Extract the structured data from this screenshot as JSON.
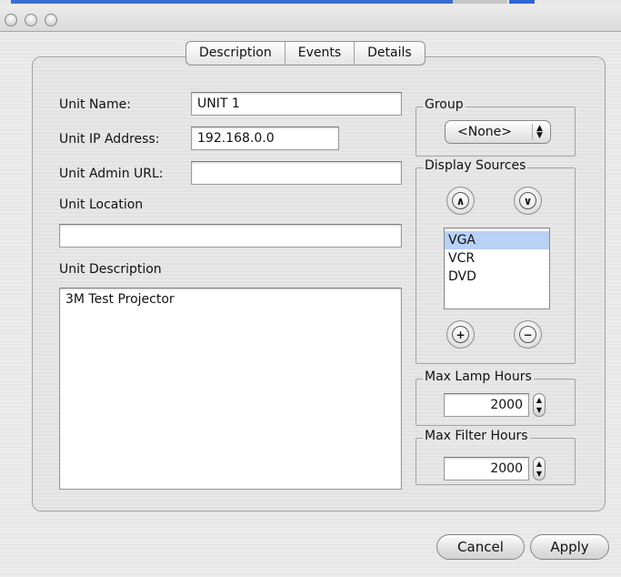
{
  "window": {
    "tabs": [
      "Description",
      "Events",
      "Details"
    ]
  },
  "form": {
    "unit_name_label": "Unit Name:",
    "unit_name_value": "UNIT 1",
    "unit_ip_label": "Unit IP Address:",
    "unit_ip_value": "192.168.0.0",
    "unit_admin_url_label": "Unit Admin URL:",
    "unit_admin_url_value": "",
    "unit_location_label": "Unit Location",
    "unit_location_value": "",
    "unit_description_label": "Unit Description",
    "unit_description_value": "3M Test Projector"
  },
  "group": {
    "title": "Group",
    "selected": "<None>"
  },
  "display_sources": {
    "title": "Display Sources",
    "items": [
      {
        "label": "VGA",
        "selected": true
      },
      {
        "label": "VCR",
        "selected": false
      },
      {
        "label": "DVD",
        "selected": false
      }
    ]
  },
  "max_lamp_hours": {
    "title": "Max Lamp Hours",
    "value": "2000"
  },
  "max_filter_hours": {
    "title": "Max Filter Hours",
    "value": "2000"
  },
  "buttons": {
    "cancel": "Cancel",
    "apply": "Apply"
  },
  "icons": {
    "move_up": "chevron-up-icon",
    "move_down": "chevron-down-icon",
    "add": "plus-icon",
    "remove": "minus-icon"
  }
}
